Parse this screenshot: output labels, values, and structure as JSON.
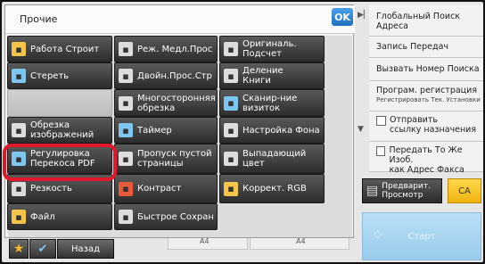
{
  "popup": {
    "title": "Прочие",
    "ok_label": "OK"
  },
  "functions": [
    {
      "label": "Работа Строит",
      "icon": "book-stack-icon",
      "icon_color": "#f4c54a"
    },
    {
      "label": "Реж. Медл.Прос",
      "icon": "document-slow-icon",
      "icon_color": "#dddddd"
    },
    {
      "label": "Оригиналь.\nПодсчет",
      "icon": "document-count-icon",
      "icon_color": "#dddddd"
    },
    {
      "label": "Стереть",
      "icon": "erase-icon",
      "icon_color": "#7ec6f0"
    },
    {
      "label": "Двойн.Прос.Стр",
      "icon": "dual-page-scan-icon",
      "icon_color": "#dddddd"
    },
    {
      "label": "Деление\nКниги",
      "icon": "book-divide-icon",
      "icon_color": "#dddddd"
    },
    {
      "label": "",
      "icon": "",
      "icon_color": "#cccccc"
    },
    {
      "label": "Многосторонняя\nобрезка",
      "icon": "multi-crop-icon",
      "icon_color": "#dddddd"
    },
    {
      "label": "Сканир-ние\nвизиток",
      "icon": "card-scan-icon",
      "icon_color": "#7ec6f0"
    },
    {
      "label": "Обрезка\nизображений",
      "icon": "image-crop-icon",
      "icon_color": "#dddddd"
    },
    {
      "label": "Таймер",
      "icon": "timer-icon",
      "icon_color": "#7ec6f0"
    },
    {
      "label": "Настройка Фона",
      "icon": "background-adjust-icon",
      "icon_color": "#dddddd"
    },
    {
      "label": "Регулировка\nПерекоса PDF",
      "icon": "pdf-skew-icon",
      "icon_color": "#7ec6f0"
    },
    {
      "label": "Пропуск пустой\nстраницы",
      "icon": "blank-page-skip-icon",
      "icon_color": "#dddddd"
    },
    {
      "label": "Выпадающий\nцвет",
      "icon": "color-dropout-icon",
      "icon_color": "#dddddd"
    },
    {
      "label": "Резкость",
      "icon": "sharpness-icon",
      "icon_color": "#dddddd"
    },
    {
      "label": "Контраст",
      "icon": "contrast-icon",
      "icon_color": "#e85a3a"
    },
    {
      "label": "Коррект. RGB",
      "icon": "rgb-adjust-icon",
      "icon_color": "#f4c54a"
    },
    {
      "label": "Файл",
      "icon": "folder-icon",
      "icon_color": "#f4c54a"
    },
    {
      "label": "Быстрое Сохран",
      "icon": "quick-save-icon",
      "icon_color": "#dddddd"
    }
  ],
  "footer": {
    "back_label": "Назад"
  },
  "right_panel": {
    "items": [
      {
        "label": "Глобальный Поиск\nАдреса"
      },
      {
        "label": "Запись Передач"
      },
      {
        "label": "Вызвать Номер Поиска"
      },
      {
        "label": "Програм. регистрация",
        "sub": "Регистрировать Тек. Установки"
      },
      {
        "label": "Отправить\nссылку назначения"
      },
      {
        "label": "Передать То Же Изоб.\nкак Адрес Факса"
      }
    ],
    "preview_label": "Предварит.\nПросмотр",
    "ca_label": "CA",
    "start_label": "Старт"
  },
  "paper": {
    "a4_left": "A4",
    "a4_right": "A4"
  },
  "colors": {
    "highlight": "#e0182a",
    "accent_blue": "#1d6fc2",
    "ca_yellow": "#f1b40f",
    "start_blue": "#9acbec"
  }
}
